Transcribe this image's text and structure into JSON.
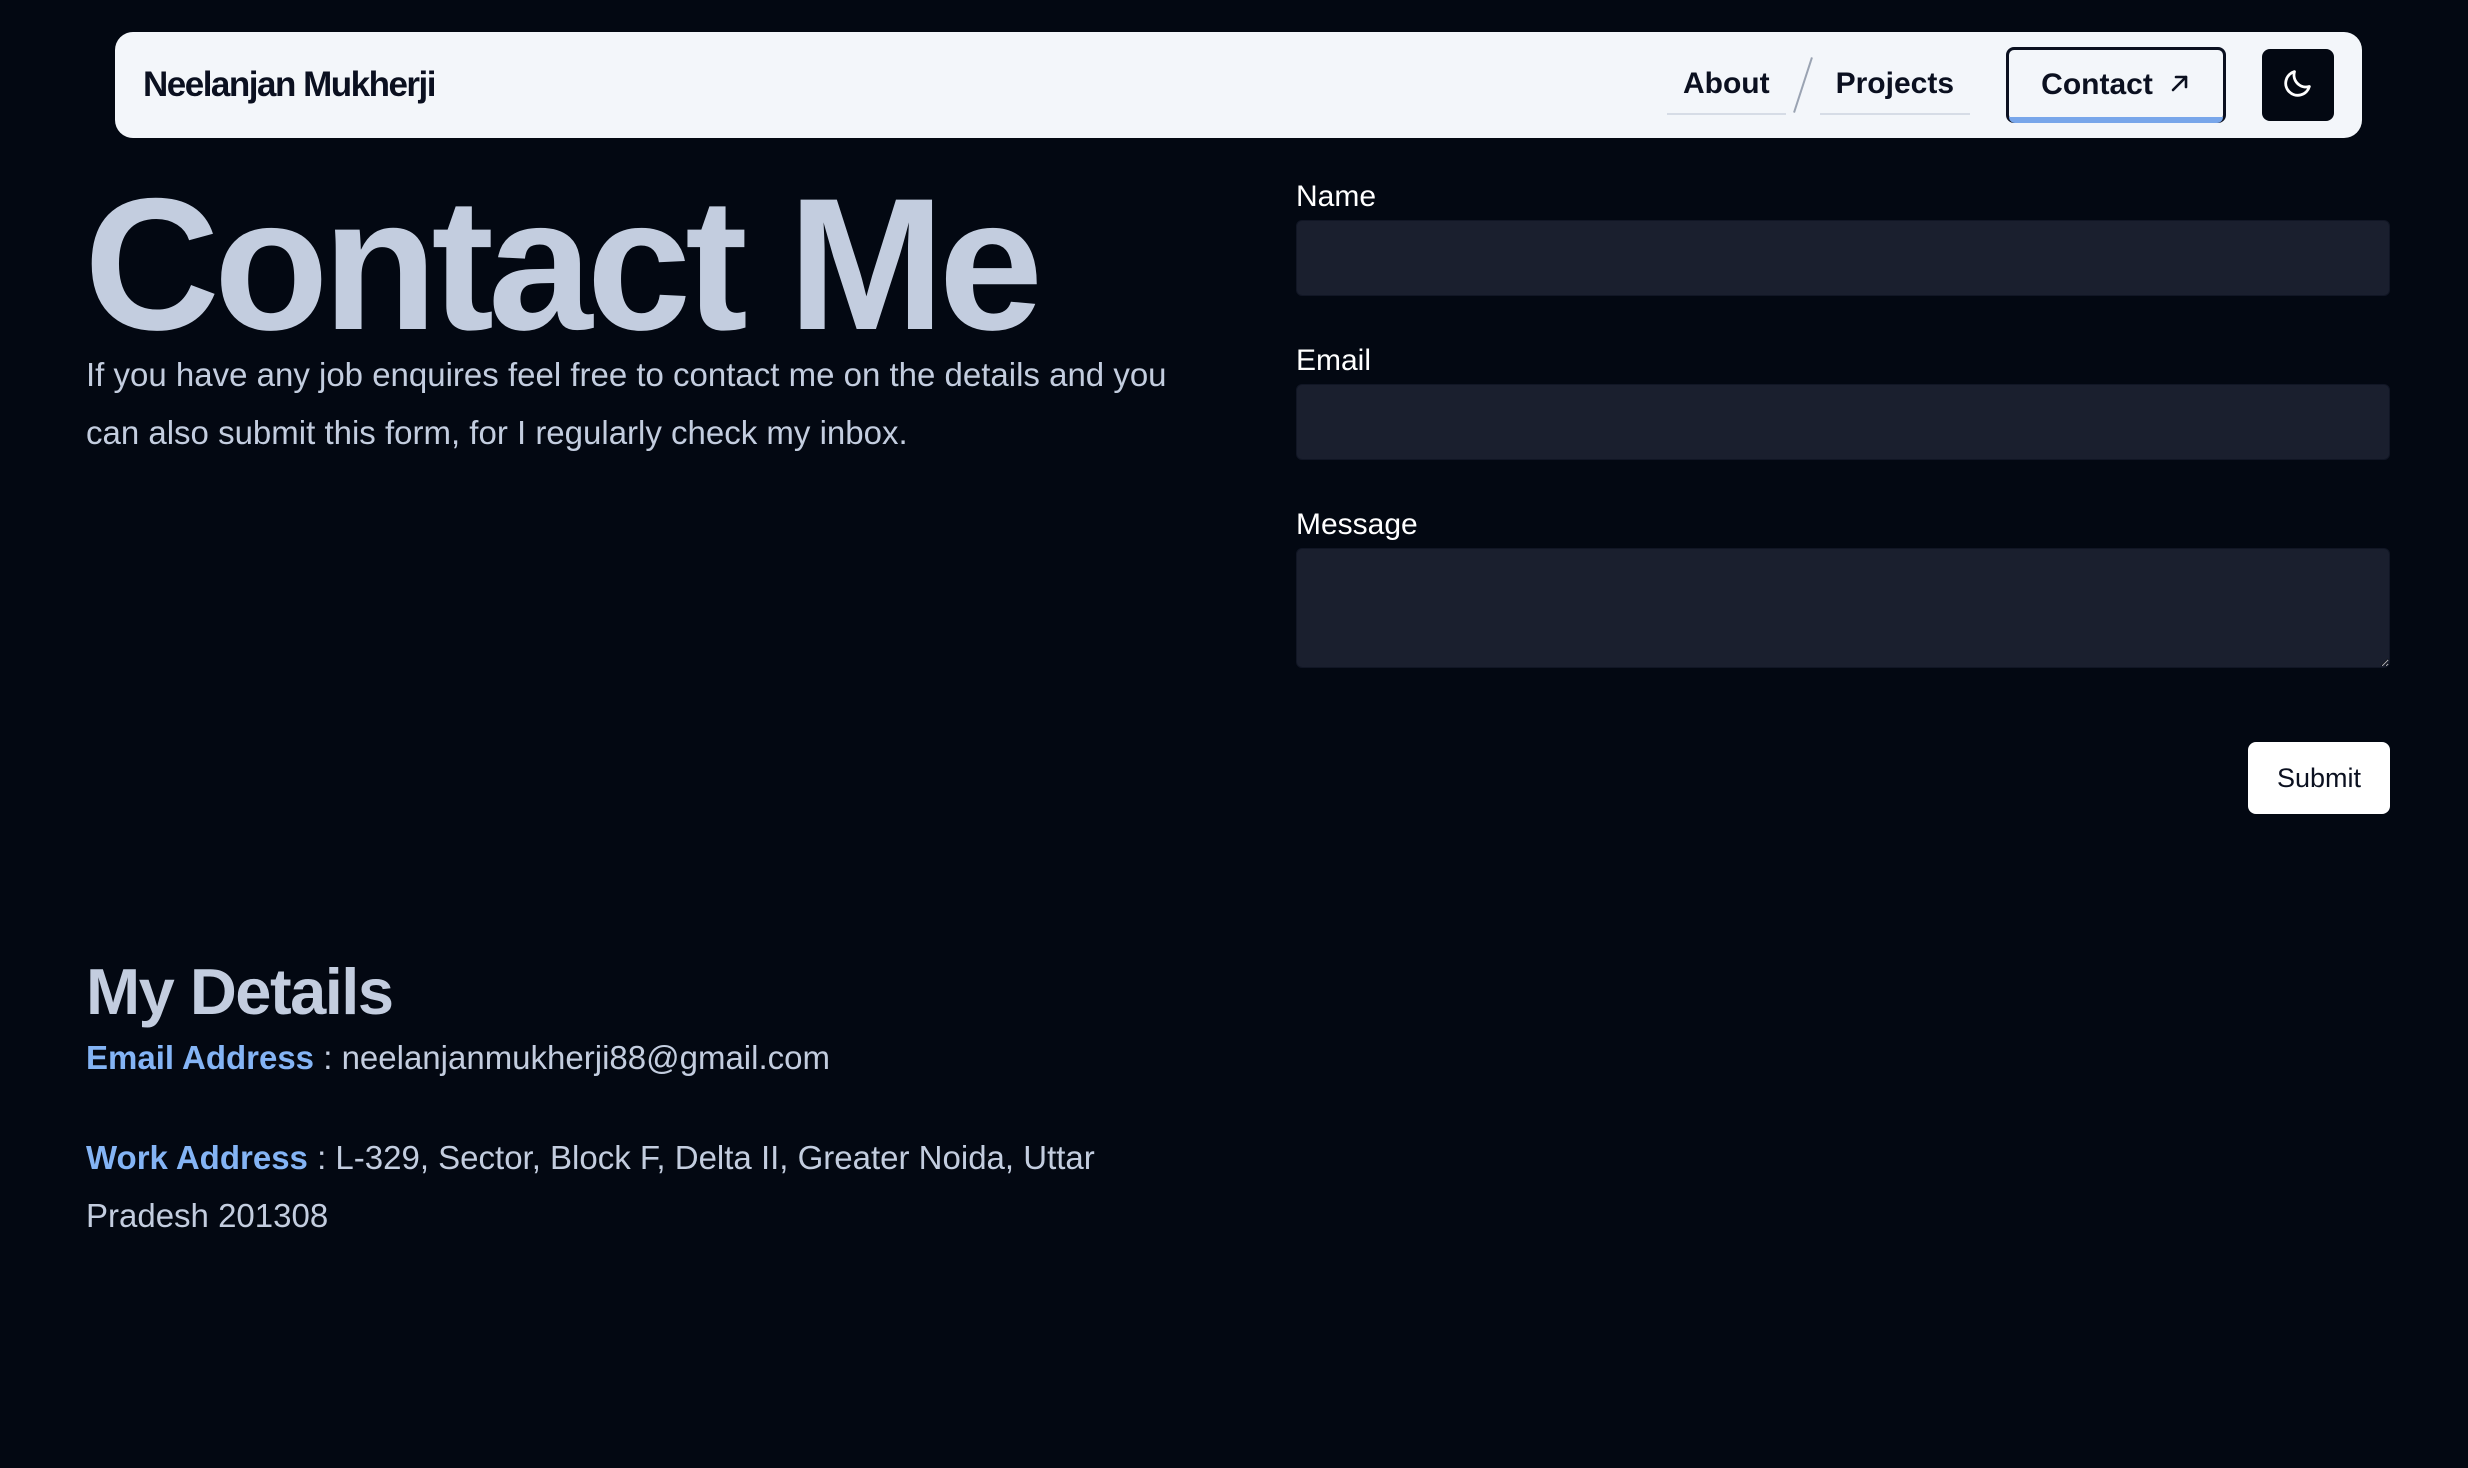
{
  "navbar": {
    "brand": "Neelanjan Mukherji",
    "links": [
      "About",
      "Projects"
    ],
    "contact_label": "Contact",
    "contact_icon": "arrow-up-right-icon",
    "theme_icon": "moon-icon"
  },
  "hero": {
    "title": "Contact Me",
    "intro": "If you have any job enquires feel free to contact me on the details and you can also submit this form, for I regularly check my inbox."
  },
  "form": {
    "name_label": "Name",
    "name_value": "",
    "email_label": "Email",
    "email_value": "",
    "message_label": "Message",
    "message_value": "",
    "submit_label": "Submit"
  },
  "details": {
    "title": "My Details",
    "email_key": "Email Address",
    "email_sep": " : ",
    "email_value": "neelanjanmukherji88@gmail.com",
    "work_key": "Work Address",
    "work_sep": " : ",
    "work_value": "L-329, Sector, Block F, Delta II, Greater Noida, Uttar Pradesh 201308"
  },
  "colors": {
    "background": "#030812",
    "navbar": "#f3f6fa",
    "heading": "#c3cddf",
    "accent": "#84b4f5",
    "input_bg": "#1a1f2e"
  }
}
